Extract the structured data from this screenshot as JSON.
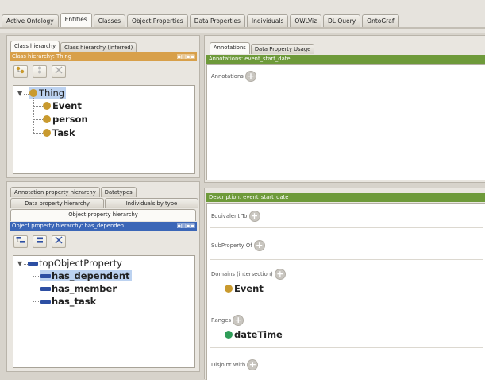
{
  "main_tabs": [
    "Active Ontology",
    "Entities",
    "Classes",
    "Object Properties",
    "Data Properties",
    "Individuals",
    "OWLViz",
    "DL Query",
    "OntoGraf"
  ],
  "active_tab": "Entities",
  "class_panel": {
    "tabs": [
      "Class hierarchy",
      "Class hierarchy (inferred)"
    ],
    "header": "Class hierarchy: Thing",
    "header_controls": "▣▤▣▣",
    "tree": {
      "root": "Thing",
      "children": [
        "Event",
        "person",
        "Task"
      ]
    }
  },
  "property_panel": {
    "tabs_row1": [
      "Annotation property hierarchy",
      "Datatypes"
    ],
    "tabs_row2": [
      "Data property hierarchy",
      "Individuals by type"
    ],
    "tabs_row3": [
      "Object property hierarchy"
    ],
    "header": "Object property hierarchy: has_dependen",
    "header_controls": "▣▤▣▣",
    "tree": {
      "root": "topObjectProperty",
      "children": [
        "has_dependent",
        "has_member",
        "has_task"
      ]
    }
  },
  "annotations_panel": {
    "tabs": [
      "Annotations",
      "Data Property Usage"
    ],
    "header": "Annotations: event_start_date",
    "label": "Annotations"
  },
  "description_panel": {
    "header": "Description: event_start_date",
    "equivalent_to": "Equivalent To",
    "subproperty_of": "SubProperty Of",
    "domains_label": "Domains (intersection)",
    "domain_value": "Event",
    "ranges_label": "Ranges",
    "range_value": "dateTime",
    "disjoint_with": "Disjoint With"
  },
  "colors": {
    "class_header": "#d8a04a",
    "property_header": "#3b66b7",
    "green_header": "#6e9a3a",
    "class_dot": "#c99a2e",
    "datatype_dot": "#2f9d58",
    "property_bar": "#2d4fa3"
  }
}
